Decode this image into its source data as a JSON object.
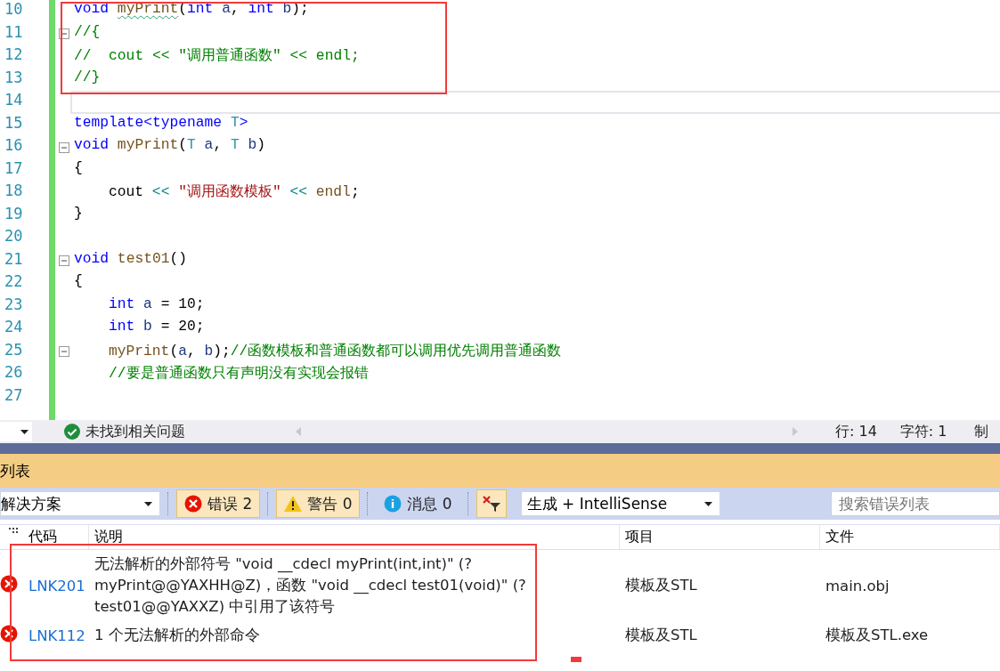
{
  "editor": {
    "lines": [
      {
        "number": "10",
        "fold": false,
        "current": false,
        "indented": false,
        "tokens": [
          {
            "kind": "kw",
            "text": "void "
          },
          {
            "kind": "fn",
            "text": "myPrint",
            "squiggle": true
          },
          {
            "kind": "plain",
            "text": "("
          },
          {
            "kind": "kw",
            "text": "int "
          },
          {
            "kind": "var",
            "text": "a"
          },
          {
            "kind": "plain",
            "text": ", "
          },
          {
            "kind": "kw",
            "text": "int "
          },
          {
            "kind": "var",
            "text": "b"
          },
          {
            "kind": "plain",
            "text": ");"
          }
        ]
      },
      {
        "number": "11",
        "fold": true,
        "current": false,
        "indented": false,
        "tokens": [
          {
            "kind": "comment",
            "text": "//{"
          }
        ]
      },
      {
        "number": "12",
        "fold": false,
        "current": false,
        "indented": false,
        "tokens": [
          {
            "kind": "comment",
            "text": "//  cout << \"调用普通函数\" << endl;"
          }
        ]
      },
      {
        "number": "13",
        "fold": false,
        "current": false,
        "indented": false,
        "tokens": [
          {
            "kind": "comment",
            "text": "//}"
          }
        ]
      },
      {
        "number": "14",
        "fold": false,
        "current": true,
        "indented": false
      },
      {
        "number": "15",
        "fold": false,
        "current": false,
        "indented": false,
        "tokens": [
          {
            "kind": "kw",
            "text": "template<typename "
          },
          {
            "kind": "type",
            "text": "T"
          },
          {
            "kind": "kw",
            "text": ">"
          }
        ]
      },
      {
        "number": "16",
        "fold": true,
        "current": false,
        "indented": false,
        "tokens": [
          {
            "kind": "kw",
            "text": "void "
          },
          {
            "kind": "fn",
            "text": "myPrint"
          },
          {
            "kind": "plain",
            "text": "("
          },
          {
            "kind": "type",
            "text": "T "
          },
          {
            "kind": "var",
            "text": "a"
          },
          {
            "kind": "plain",
            "text": ", "
          },
          {
            "kind": "type",
            "text": "T "
          },
          {
            "kind": "var",
            "text": "b"
          },
          {
            "kind": "plain",
            "text": ")"
          }
        ]
      },
      {
        "number": "17",
        "fold": false,
        "current": false,
        "indented": false,
        "tokens": [
          {
            "kind": "plain",
            "text": "{"
          }
        ]
      },
      {
        "number": "18",
        "fold": false,
        "current": false,
        "indented": true,
        "tokens": [
          {
            "kind": "plain",
            "text": "cout "
          },
          {
            "kind": "op",
            "text": "<< "
          },
          {
            "kind": "str",
            "text": "\"调用函数模板\""
          },
          {
            "kind": "op",
            "text": " << "
          },
          {
            "kind": "fn",
            "text": "endl"
          },
          {
            "kind": "plain",
            "text": ";"
          }
        ]
      },
      {
        "number": "19",
        "fold": false,
        "current": false,
        "indented": false,
        "tokens": [
          {
            "kind": "plain",
            "text": "}"
          }
        ]
      },
      {
        "number": "20",
        "fold": false,
        "current": false
      },
      {
        "number": "21",
        "fold": true,
        "current": false,
        "indented": false,
        "tokens": [
          {
            "kind": "kw",
            "text": "void "
          },
          {
            "kind": "fn",
            "text": "test01"
          },
          {
            "kind": "plain",
            "text": "()"
          }
        ]
      },
      {
        "number": "22",
        "fold": false,
        "current": false,
        "indented": false,
        "tokens": [
          {
            "kind": "plain",
            "text": "{"
          }
        ]
      },
      {
        "number": "23",
        "fold": false,
        "current": false,
        "indented": true,
        "tokens": [
          {
            "kind": "kw",
            "text": "int "
          },
          {
            "kind": "var",
            "text": "a"
          },
          {
            "kind": "plain",
            "text": " = 10;"
          }
        ]
      },
      {
        "number": "24",
        "fold": false,
        "current": false,
        "indented": true,
        "tokens": [
          {
            "kind": "kw",
            "text": "int "
          },
          {
            "kind": "var",
            "text": "b"
          },
          {
            "kind": "plain",
            "text": " = 20;"
          }
        ]
      },
      {
        "number": "25",
        "fold": true,
        "current": false,
        "indented": true,
        "tokens": [
          {
            "kind": "fn",
            "text": "myPrint"
          },
          {
            "kind": "plain",
            "text": "("
          },
          {
            "kind": "var",
            "text": "a"
          },
          {
            "kind": "plain",
            "text": ", "
          },
          {
            "kind": "var",
            "text": "b"
          },
          {
            "kind": "plain",
            "text": ");"
          },
          {
            "kind": "comment",
            "text": "//函数模板和普通函数都可以调用优先调用普通函数"
          }
        ]
      },
      {
        "number": "26",
        "fold": false,
        "current": false,
        "indented": true,
        "tokens": [
          {
            "kind": "comment",
            "text": "//要是普通函数只有声明没有实现会报错"
          }
        ]
      },
      {
        "number": "27",
        "fold": false,
        "current": false
      }
    ]
  },
  "status_bar": {
    "message": "未找到相关问题",
    "line": "行: 14",
    "column": "字符: 1",
    "tab_mode": "制"
  },
  "error_list": {
    "title": "列表",
    "scope": "解决方案",
    "filters": [
      {
        "kind": "error",
        "label": "错误 2",
        "selected": true
      },
      {
        "kind": "warning",
        "label": "警告 0",
        "selected": true
      },
      {
        "kind": "info",
        "label": "消息 0",
        "selected": false
      }
    ],
    "clear_filter": {
      "selected": true
    },
    "source": "生成 + IntelliSense",
    "search": {
      "placeholder": "搜索错误列表"
    },
    "columns": [
      "代码",
      "说明",
      "项目",
      "文件"
    ],
    "rows": [
      {
        "kind": "error",
        "code": "LNK201",
        "description": "无法解析的外部符号 \"void __cdecl myPrint(int,int)\" (?myPrint@@YAXHH@Z)，函数 \"void __cdecl test01(void)\" (?test01@@YAXXZ) 中引用了该符号",
        "project": "模板及STL",
        "file": "main.obj"
      },
      {
        "kind": "error",
        "code": "LNK112",
        "description": "1 个无法解析的外部命令",
        "project": "模板及STL",
        "file": "模板及STL.exe"
      }
    ]
  }
}
